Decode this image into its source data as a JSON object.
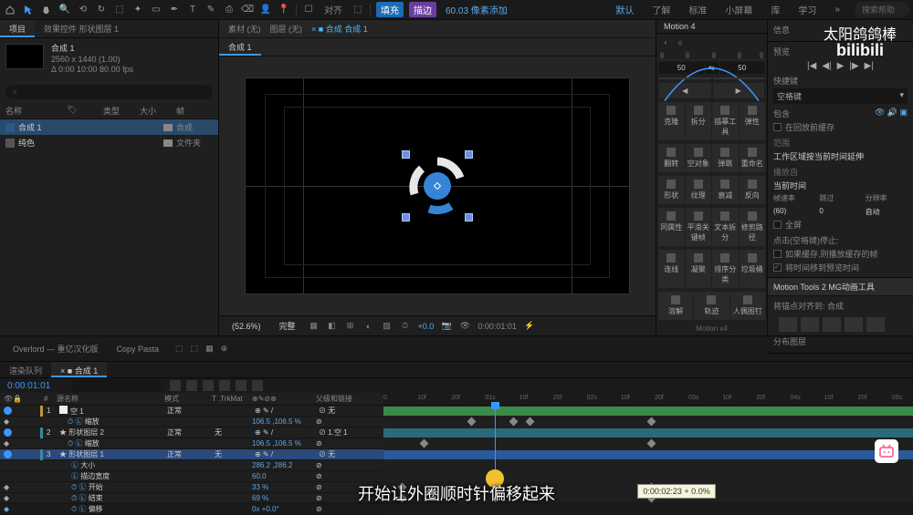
{
  "watermark_channel": "太阳鸽鸽棒",
  "watermark_site": "bilibili",
  "subtitle_text": "开始让外圈顺时针偏移起来",
  "top_menu": {
    "snap_label": "对齐",
    "fill": "填充",
    "stroke": "描边",
    "px_value": "60.03 像素添加",
    "default": "默认",
    "learn1": "了解",
    "standard": "标准",
    "smallscreen": "小屏幕",
    "lib": "库",
    "study": "学习",
    "search_placeholder": "搜索帮助"
  },
  "panels": {
    "project_tab": "项目",
    "effects_tab": "效果控件 形状图层 1",
    "comp_name": "合成 1",
    "comp_res": "2560 x 1440 (1.00)",
    "comp_fps": "Δ 0:00 10:00 80.00 fps",
    "col_name": "名称",
    "col_type": "类型",
    "col_size": "大小",
    "col_fps": "帧",
    "row1": "合成 1",
    "row1_type": "合成",
    "row2": "纯色",
    "row2_type": "文件夹"
  },
  "comp_header": {
    "composition": "素材 (无)",
    "layer": "图层 (无)",
    "comp": "合成 合成 1",
    "comp_active": "合成 1"
  },
  "viewer_footer": {
    "zoom": "(52.6%)",
    "quality": "完整",
    "cam": "+0.0",
    "time": "0:00:01:01"
  },
  "motion": {
    "tab": "Motion 4",
    "preview": "预览",
    "val_left": "50",
    "val_mid": "",
    "val_right": "50",
    "buttons_r1": [
      "克隆",
      "拆分",
      "描摹工具",
      "弹性"
    ],
    "buttons_r2": [
      "翻转",
      "空对象",
      "弹跳",
      "重命名"
    ],
    "buttons_r3": [
      "形状",
      "纹理",
      "衰减",
      "反向"
    ],
    "buttons_r4": [
      "同属性",
      "平滑关键帧",
      "文本拆分",
      "修剪路径"
    ],
    "buttons_r5": [
      "连线",
      "凝聚",
      "排序分类",
      "垃圾桶"
    ],
    "buttons_r6": [
      "溶解",
      "轨迹",
      "人偶图钉"
    ],
    "footer": "Motion v4"
  },
  "info": {
    "info_title": "信息",
    "preview_title": "预览",
    "shortcut_title": "快捷键",
    "shortcut_val": "空格键",
    "include_title": "包含",
    "cache_before": "在回放前缓存",
    "range": "工作区域按当前时间延伸",
    "playfrom": "播放自",
    "current": "当前时间",
    "framerate": "帧速率",
    "skip": "跳过",
    "res": "分辨率",
    "fr_val": "(60)",
    "skip_val": "0",
    "res_val": "自动",
    "fullscreen": "全屏",
    "spacebar_stop": "点击(空格键)停止:",
    "cache_on_play": "如果缓存,则播放缓存的帧",
    "move_time": "将时间移到预览时间",
    "tools_title": "Motion Tools 2 MG动画工具",
    "anchor_title": "将锚点对齐到: 合成",
    "distribute_title": "分布图层"
  },
  "mid": {
    "overlord": "Overlord — 重亿汉化版",
    "copypasta": "Copy Pasta"
  },
  "timeline": {
    "tab_render": "渲染队列",
    "tab_comp": "合成 1",
    "timecode": "0:00:01:01",
    "col_source": "源名称",
    "col_mode": "模式",
    "col_trkmat": "T .TrkMat",
    "col_parent": "父级和链接",
    "layer1": "空 1",
    "layer1_mode": "正常",
    "layer1_prop_scale": "缩放",
    "layer1_scale_val": "106.5 ,106.5 %",
    "layer2": "形状图层 2",
    "layer2_none": "无",
    "layer2_prop_scale": "缩放",
    "layer2_scale_val": "106.5 ,106.5 %",
    "layer2_parent": "1.空 1",
    "layer3": "形状图层 1",
    "layer3_mode": "正常",
    "layer3_none": "无",
    "layer3_parent": "无",
    "layer3_prop_size": "大小",
    "layer3_size_val": "286.2 ,286.2",
    "layer3_prop_stroke": "描边宽度",
    "layer3_stroke_val": "60.0",
    "layer3_prop_start": "开始",
    "layer3_start_val": "33 %",
    "layer3_prop_end": "结束",
    "layer3_end_val": "69 %",
    "layer3_prop_offset": "偏移",
    "layer3_offset_val": "0x +0.0°",
    "ruler_marks": [
      "0",
      "10f",
      "20f",
      "01s",
      "10f",
      "20f",
      "02s",
      "10f",
      "20f",
      "03s",
      "10f",
      "20f",
      "04s",
      "10f",
      "20f",
      "05s"
    ],
    "tooltip": "0:00:02:23 + 0.0%"
  }
}
